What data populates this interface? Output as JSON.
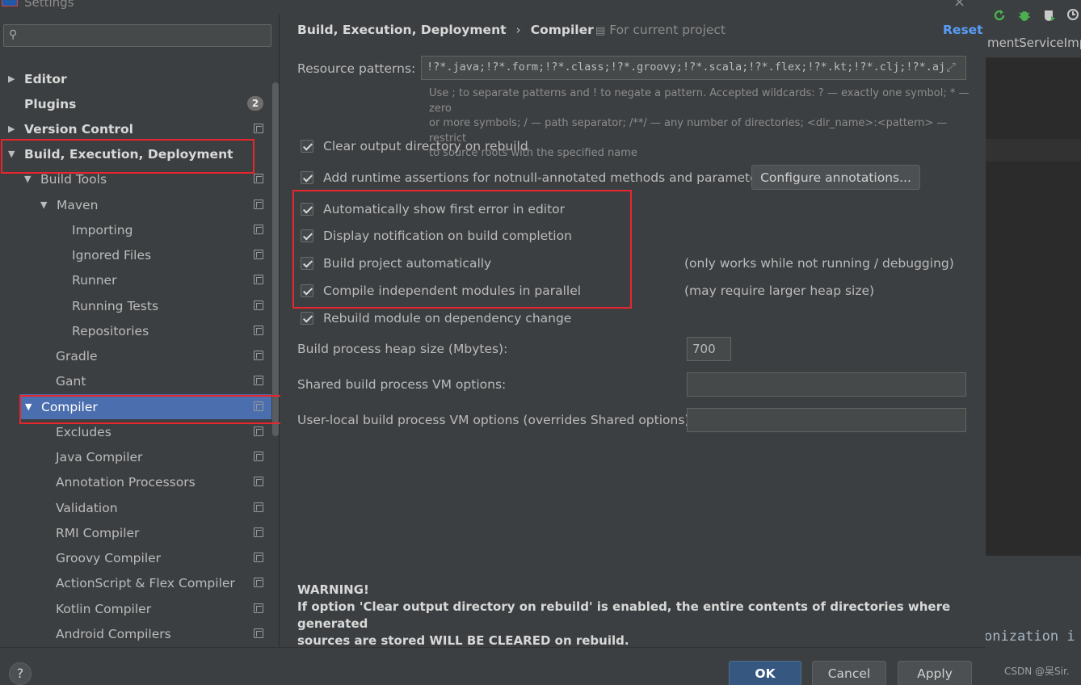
{
  "window": {
    "title": "Settings"
  },
  "search": {
    "placeholder": ""
  },
  "sidebar": {
    "items": [
      {
        "label": "Editor",
        "expanded": false,
        "bold": true
      },
      {
        "label": "Plugins",
        "bold": true,
        "badge": "2"
      },
      {
        "label": "Version Control",
        "expanded": false,
        "bold": true
      },
      {
        "label": "Build, Execution, Deployment",
        "expanded": true,
        "bold": true
      },
      {
        "label": "Build Tools",
        "expanded": true
      },
      {
        "label": "Maven",
        "expanded": true
      },
      {
        "label": "Importing"
      },
      {
        "label": "Ignored Files"
      },
      {
        "label": "Runner"
      },
      {
        "label": "Running Tests"
      },
      {
        "label": "Repositories"
      },
      {
        "label": "Gradle"
      },
      {
        "label": "Gant"
      },
      {
        "label": "Compiler",
        "expanded": true,
        "selected": true
      },
      {
        "label": "Excludes"
      },
      {
        "label": "Java Compiler"
      },
      {
        "label": "Annotation Processors"
      },
      {
        "label": "Validation"
      },
      {
        "label": "RMI Compiler"
      },
      {
        "label": "Groovy Compiler"
      },
      {
        "label": "ActionScript & Flex Compiler"
      },
      {
        "label": "Kotlin Compiler"
      },
      {
        "label": "Android Compilers"
      }
    ]
  },
  "header": {
    "breadcrumb": [
      "Build, Execution, Deployment",
      "Compiler"
    ],
    "separator": "›",
    "scope": "For current project",
    "reset": "Reset"
  },
  "compiler": {
    "resource_patterns_label": "Resource patterns:",
    "resource_patterns_value": "!?*.java;!?*.form;!?*.class;!?*.groovy;!?*.scala;!?*.flex;!?*.kt;!?*.clj;!?*.aj",
    "hint_line1": "Use ; to separate patterns and ! to negate a pattern. Accepted wildcards: ? — exactly one symbol; * — zero",
    "hint_line2": "or more symbols; / — path separator; /**/ — any number of directories; <dir_name>:<pattern> — restrict",
    "hint_line3": "to source roots with the specified name",
    "options": [
      {
        "label": "Clear output directory on rebuild",
        "checked": true
      },
      {
        "label": "Add runtime assertions for notnull-annotated methods and parameters",
        "checked": true
      },
      {
        "label": "Automatically show first error in editor",
        "checked": true
      },
      {
        "label": "Display notification on build completion",
        "checked": true
      },
      {
        "label": "Build project automatically",
        "checked": true,
        "note": "(only works while not running / debugging)"
      },
      {
        "label": "Compile independent modules in parallel",
        "checked": true,
        "note": "(may require larger heap size)"
      },
      {
        "label": "Rebuild module on dependency change",
        "checked": true
      }
    ],
    "configure_annotations": "Configure annotations...",
    "heap_label": "Build process heap size (Mbytes):",
    "heap_value": "700",
    "shared_vm_label": "Shared build process VM options:",
    "shared_vm_value": "",
    "user_vm_label": "User-local build process VM options (overrides Shared options):",
    "user_vm_value": "",
    "warning_title": "WARNING!",
    "warning_line1": "If option 'Clear output directory on rebuild' is enabled, the entire contents of directories where generated",
    "warning_line2": "sources are stored WILL BE CLEARED on rebuild."
  },
  "buttons": {
    "ok": "OK",
    "cancel": "Cancel",
    "apply": "Apply",
    "help": "?"
  },
  "ide": {
    "tab": "mentServiceImp",
    "code": "onization i"
  },
  "watermark": "CSDN @吴Sir.",
  "colors": {
    "accent": "#4b6eaf",
    "link": "#589df6",
    "highlight_box": "#e8262e",
    "primary_button": "#365880"
  }
}
